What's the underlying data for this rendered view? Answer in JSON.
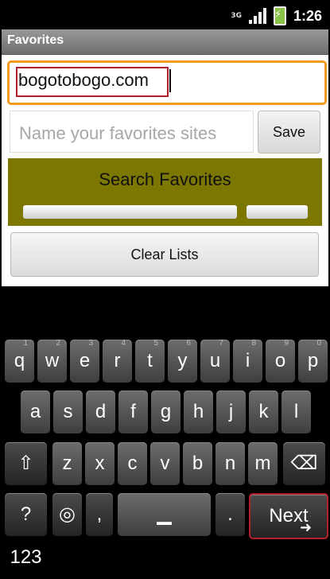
{
  "status_bar": {
    "network": "3G",
    "time": "1:26",
    "colors": {
      "battery": "#8bc34a"
    }
  },
  "app": {
    "title": "Favorites",
    "url_value": "bogotobogo.com",
    "name_placeholder": "Name your favorites sites",
    "save_label": "Save",
    "search_title": "Search Favorites",
    "clear_label": "Clear Lists",
    "colors": {
      "accent": "#f39a1e",
      "panel": "#7b7700",
      "highlight": "#b3202d"
    }
  },
  "keyboard": {
    "row1": [
      {
        "main": "q",
        "alt": "1"
      },
      {
        "main": "w",
        "alt": "2"
      },
      {
        "main": "e",
        "alt": "3"
      },
      {
        "main": "r",
        "alt": "4"
      },
      {
        "main": "t",
        "alt": "5"
      },
      {
        "main": "y",
        "alt": "6"
      },
      {
        "main": "u",
        "alt": "7"
      },
      {
        "main": "i",
        "alt": "8"
      },
      {
        "main": "o",
        "alt": "9"
      },
      {
        "main": "p",
        "alt": "0"
      }
    ],
    "row2": [
      "a",
      "s",
      "d",
      "f",
      "g",
      "h",
      "j",
      "k",
      "l"
    ],
    "row3": [
      "z",
      "x",
      "c",
      "v",
      "b",
      "n",
      "m"
    ],
    "symbols_label": "?123",
    "comma_label": ",",
    "period_label": ".",
    "next_label": "Next",
    "icons": [
      "shift-icon",
      "backspace-icon",
      "settings-icon",
      "space-bar",
      "pointer-icon"
    ]
  }
}
